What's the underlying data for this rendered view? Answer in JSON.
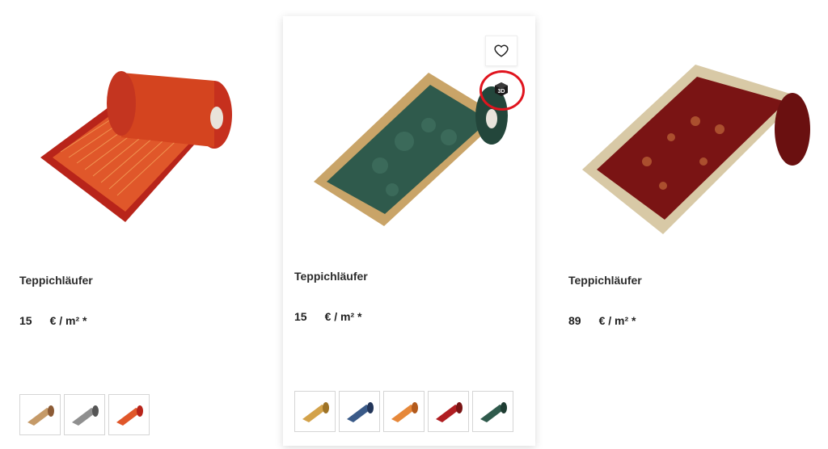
{
  "products": [
    {
      "title": "Teppichläufer",
      "price_value": "15",
      "price_unit": "€ / m² *",
      "swatches": [
        "beige-runner",
        "grey-runner",
        "orange-runner"
      ]
    },
    {
      "title": "Teppichläufer",
      "price_value": "15",
      "price_unit": "€ / m² *",
      "swatches": [
        "gold-runner",
        "blue-runner",
        "orange-runner",
        "red-runner",
        "green-runner"
      ],
      "actions": {
        "wishlist_icon": "heart-icon",
        "view3d_icon": "3d-cube-icon",
        "view3d_label": "3D"
      }
    },
    {
      "title": "Teppichläufer",
      "price_value": "89",
      "price_unit": "€ / m² *"
    }
  ],
  "colors": {
    "highlight": "#e0141e",
    "left_runner": "#e0572a",
    "left_border": "#b8241a",
    "mid_runner": "#2f5a4c",
    "mid_border": "#c9a468",
    "right_runner": "#7a1414",
    "right_border": "#d8c9a6"
  }
}
